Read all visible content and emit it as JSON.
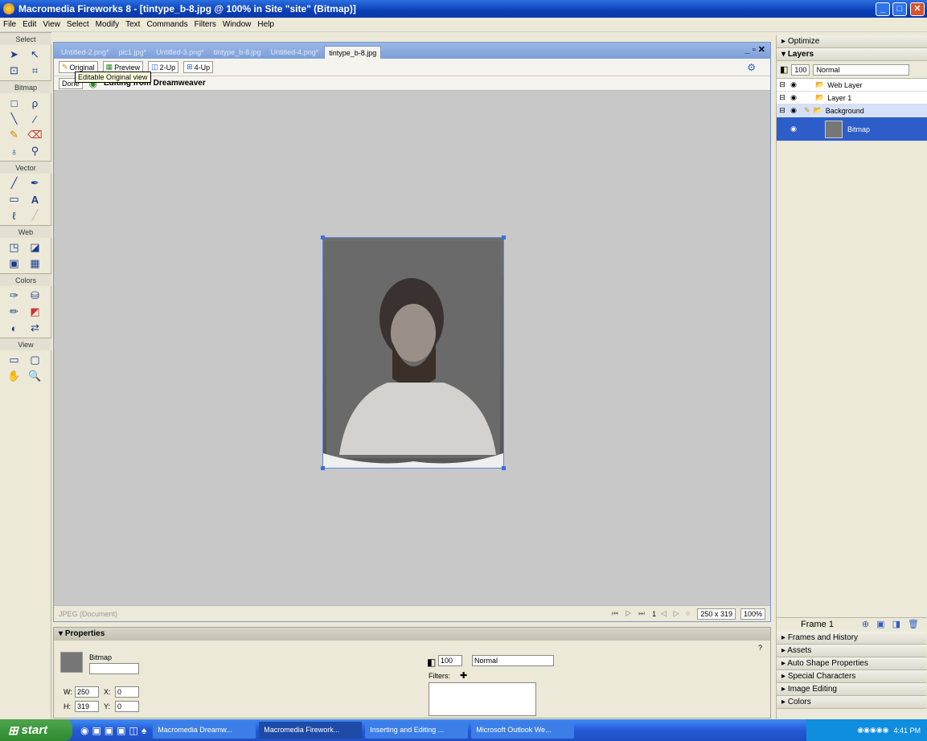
{
  "window": {
    "title": "Macromedia Fireworks 8 - [tintype_b-8.jpg @ 100% in Site \"site\" (Bitmap)]"
  },
  "menu": [
    "File",
    "Edit",
    "View",
    "Select",
    "Modify",
    "Text",
    "Commands",
    "Filters",
    "Window",
    "Help"
  ],
  "tools": {
    "sections": [
      "Select",
      "Bitmap",
      "Vector",
      "Web",
      "Colors",
      "View"
    ]
  },
  "doc": {
    "tabs": [
      "Untitled-2.png*",
      "pic1.jpg*",
      "Untitled-3.png*",
      "tintype_b-8.jpg",
      "Untitled-4.png*",
      "tintype_b-8.jpg"
    ],
    "view_buttons": [
      "Original",
      "Preview",
      "2-Up",
      "4-Up"
    ],
    "done_label": "Done",
    "editing_label": "Editing from Dreamweaver",
    "tooltip": "Editable Original view",
    "status_left": "JPEG (Document)",
    "frame_num": "1",
    "dimensions": "250 x 319",
    "zoom": "100%"
  },
  "properties": {
    "title": "Properties",
    "object_type": "Bitmap",
    "w_label": "W:",
    "w": "250",
    "h_label": "H:",
    "h": "319",
    "x_label": "X:",
    "x": "0",
    "y_label": "Y:",
    "y": "0",
    "opacity": "100",
    "blend": "Normal",
    "filters_label": "Filters:"
  },
  "panels": {
    "optimize": "Optimize",
    "layers": "Layers",
    "layer_opacity": "100",
    "layer_blend": "Normal",
    "layer_items": [
      "Web Layer",
      "Layer 1",
      "Background",
      "Bitmap"
    ],
    "frame_label": "Frame 1",
    "collapsed": [
      "Frames and History",
      "Assets",
      "Auto Shape Properties",
      "Special Characters",
      "Image Editing",
      "Colors"
    ]
  },
  "taskbar": {
    "start": "start",
    "tasks": [
      "Macromedia Dreamw...",
      "Macromedia Firework...",
      "Inserting and Editing ...",
      "Microsoft Outlook We..."
    ],
    "clock": "4:41 PM"
  }
}
